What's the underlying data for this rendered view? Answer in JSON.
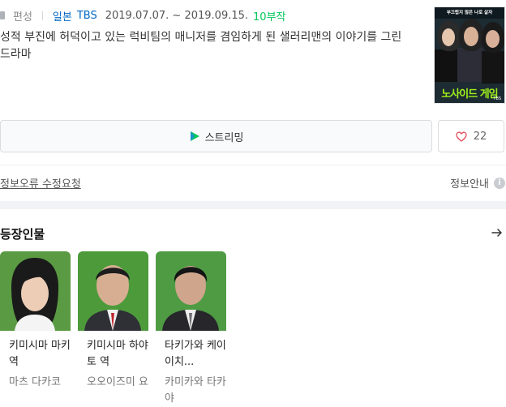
{
  "meta": {
    "label": "편성",
    "country": "일본",
    "network": "TBS",
    "dates": "2019.07.07. ~ 2019.09.15.",
    "episodes": "10부작"
  },
  "description": "성적 부진에 허덕이고 있는 럭비팀의 매니저를 겸임하게 된 샐러리맨의 이야기를 그린 드라마",
  "poster": {
    "top_text": "부끄럽지 않은 나로 살자",
    "title": "노사이드 게임",
    "network": "TBS"
  },
  "buttons": {
    "stream_label": "스트리밍",
    "like_count": "22"
  },
  "links": {
    "report": "정보오류 수정요청",
    "info": "정보안내"
  },
  "cast_section": {
    "title": "등장인물",
    "cast": [
      {
        "role": "키미시마 마키 역",
        "actor": "마츠 다카코"
      },
      {
        "role": "키미시마 하야토 역",
        "actor": "오오이즈미 요"
      },
      {
        "role": "타키가와 케이이치...",
        "actor": "카미카와 타카야"
      }
    ]
  },
  "colors": {
    "link_blue": "#0068c3",
    "episodes_green": "#03c75a",
    "heart_red": "#e4505f"
  },
  "icons": {
    "stream": "play-icon",
    "like": "heart-icon",
    "info": "info-icon",
    "more": "arrow-right-icon"
  }
}
